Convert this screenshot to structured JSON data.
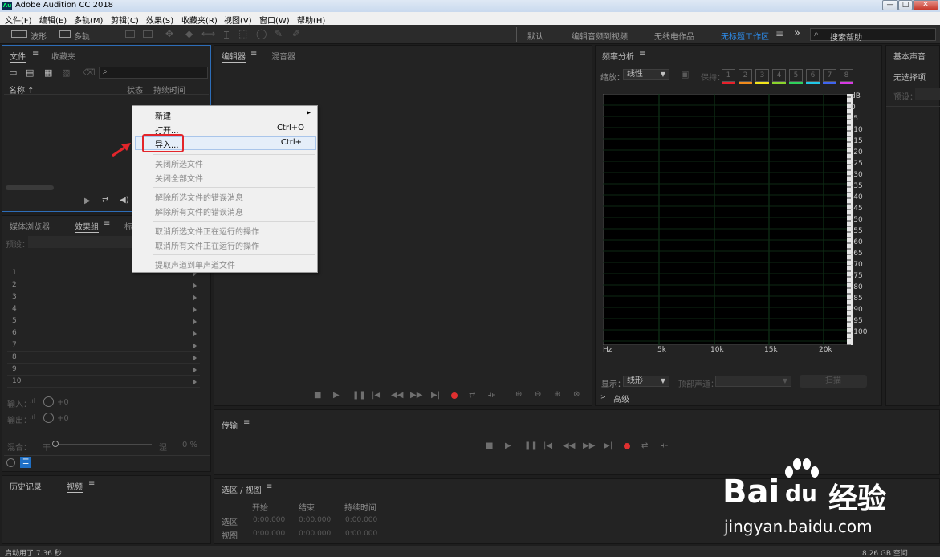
{
  "window": {
    "title": "Adobe Audition CC 2018",
    "icon_text": "Au",
    "minimize": "—",
    "maximize": "□",
    "close": "✕"
  },
  "menu": [
    "文件(F)",
    "编辑(E)",
    "多轨(M)",
    "剪辑(C)",
    "效果(S)",
    "收藏夹(R)",
    "视图(V)",
    "窗口(W)",
    "帮助(H)"
  ],
  "toolbar": {
    "waveform": "波形",
    "multitrack": "多轨",
    "workspaces": [
      "默认",
      "编辑音频到视频",
      "无线电作品",
      "无标题工作区"
    ],
    "more": "»",
    "search_placeholder": "搜索帮助"
  },
  "files_panel": {
    "tabs": [
      "文件",
      "收藏夹"
    ],
    "menu_icon": "≡",
    "search_icon": "⌕",
    "columns": [
      "名称 ↑",
      "状态",
      "持续时间"
    ]
  },
  "context_menu": {
    "items": [
      {
        "label": "新建",
        "shortcut": "",
        "submenu": "▸",
        "enabled": true
      },
      {
        "label": "打开...",
        "shortcut": "Ctrl+O",
        "enabled": true
      },
      {
        "label": "导入...",
        "shortcut": "Ctrl+I",
        "enabled": true,
        "highlighted": true
      },
      {
        "label": "关闭所选文件",
        "enabled": false
      },
      {
        "label": "关闭全部文件",
        "enabled": false
      },
      {
        "label": "解除所选文件的错误消息",
        "enabled": false
      },
      {
        "label": "解除所有文件的错误消息",
        "enabled": false
      },
      {
        "label": "取消所选文件正在运行的操作",
        "enabled": false
      },
      {
        "label": "取消所有文件正在运行的操作",
        "enabled": false
      },
      {
        "label": "提取声道到单声道文件",
        "enabled": false
      }
    ]
  },
  "left_middle": {
    "tabs": [
      "媒体浏览器",
      "效果组",
      "标"
    ],
    "preset_label": "预设：",
    "rows": [
      "1",
      "2",
      "3",
      "4",
      "5",
      "6",
      "7",
      "8",
      "9",
      "10"
    ],
    "input_label": "输入：",
    "output_label": "输出：",
    "input_db": "+0",
    "output_db": "+0",
    "mix_label": "混合：",
    "dry": "干",
    "wet": "湿",
    "mix_value": "0 %"
  },
  "history_panel": {
    "tabs": [
      "历史记录",
      "视频"
    ]
  },
  "editor_panel": {
    "tabs": [
      "编辑器",
      "混音器"
    ]
  },
  "transport_panel": {
    "title": "传输"
  },
  "selection_panel": {
    "title": "选区 / 视图",
    "columns": [
      "开始",
      "结束",
      "持续时间"
    ],
    "rows": [
      {
        "label": "选区",
        "start": "0:00.000",
        "end": "0:00.000",
        "duration": "0:00.000"
      },
      {
        "label": "视图",
        "start": "0:00.000",
        "end": "0:00.000",
        "duration": "0:00.000"
      }
    ]
  },
  "frequency_panel": {
    "title": "频率分析",
    "scale_label": "缩放：",
    "scale_value": "线性",
    "hold_label": "保持：",
    "channels": [
      "1",
      "2",
      "3",
      "4",
      "5",
      "6",
      "7",
      "8"
    ],
    "channel_colors": [
      "#e8202a",
      "#f08a1c",
      "#f2e41b",
      "#8bd32c",
      "#2fd15c",
      "#21c7e6",
      "#3f64f0",
      "#d63ae2"
    ],
    "db_labels": [
      "dB",
      "0",
      "-5",
      "-10",
      "-15",
      "-20",
      "-25",
      "-30",
      "-35",
      "-40",
      "-45",
      "-50",
      "-55",
      "-60",
      "-65",
      "-70",
      "-75",
      "-80",
      "-85",
      "-90",
      "-95",
      "-100"
    ],
    "hz_labels": [
      "Hz",
      "5k",
      "10k",
      "15k",
      "20k"
    ],
    "display_label": "显示：",
    "display_value": "线形",
    "top_channel_label": "顶部声道：",
    "scan_button": "扫描",
    "advanced": "高级"
  },
  "essential_sound": {
    "title": "基本声音",
    "no_selection": "无选择项",
    "preset_label": "预设："
  },
  "status": {
    "left": "启动用了 7.36 秒",
    "right": "8.26 GB 空间"
  },
  "watermark": {
    "brand": "Bai",
    "brand_du": "du",
    "brand_cn": "经验",
    "url": "jingyan.baidu.com"
  }
}
